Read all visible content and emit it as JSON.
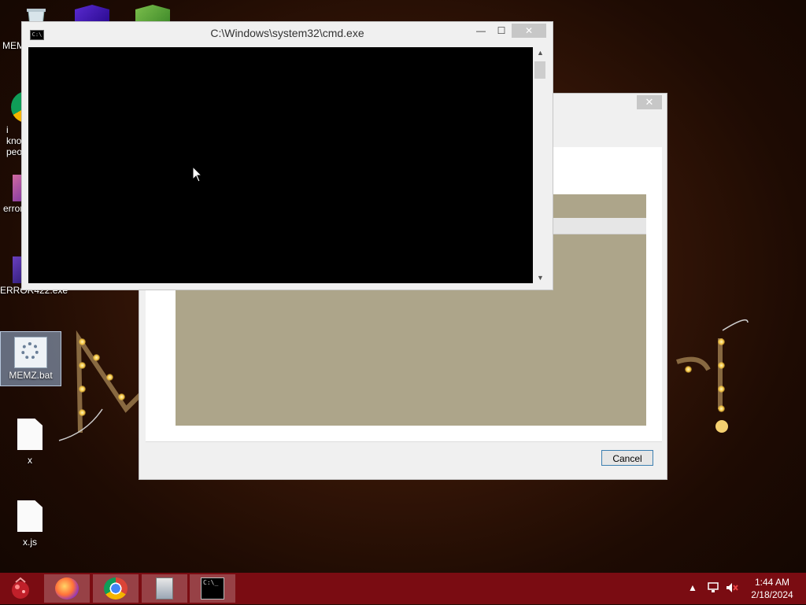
{
  "desktop": {
    "icons": [
      {
        "label": "MEMZ",
        "kind": "recycle"
      },
      {
        "label": "i know people",
        "kind": "chrome"
      },
      {
        "label": "error",
        "kind": "cube"
      },
      {
        "label": "ERROR422.exe",
        "kind": "cube"
      },
      {
        "label": "MEMZ.bat",
        "kind": "bat"
      },
      {
        "label": "x",
        "kind": "file"
      },
      {
        "label": "x.js",
        "kind": "file"
      }
    ]
  },
  "cmd_window": {
    "title": "C:\\Windows\\system32\\cmd.exe",
    "icon_text": "C:\\"
  },
  "dialog": {
    "cancel_label": "Cancel"
  },
  "taskbar": {
    "apps": [
      {
        "name": "firefox-icon"
      },
      {
        "name": "chrome-icon"
      },
      {
        "name": "installer-icon"
      },
      {
        "name": "cmd-icon"
      }
    ],
    "cmd_icon_text": "C:\\_",
    "time": "1:44 AM",
    "date": "2/18/2024"
  },
  "colors": {
    "taskbar": "#7a0c12",
    "progress_fill": "#ada58a",
    "console": "#000000"
  }
}
